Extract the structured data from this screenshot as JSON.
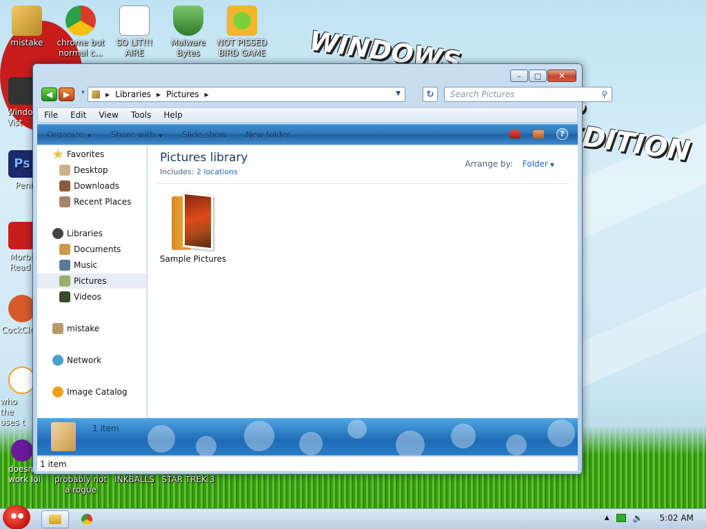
{
  "desktop": {
    "top_icons": [
      {
        "label": "mistake",
        "color": "#c89a2a"
      },
      {
        "label": "chrome but normal c...",
        "color": "#2a8ad8"
      },
      {
        "label": "SO LIT!!! AIRE",
        "color": "#ffffff"
      },
      {
        "label": "Malware Bytes",
        "color": "#4a9a3a"
      },
      {
        "label": "NOT PISSED BIRD GAME",
        "color": "#f2b62a"
      }
    ],
    "side_icons": [
      {
        "label": "Windo Vist",
        "color": "#333333"
      },
      {
        "label": "Peni",
        "color": "#1a2a6a"
      },
      {
        "label": "Morbi Read",
        "color": "#c81d1d"
      },
      {
        "label": "CockCle",
        "color": "#d85a2a"
      },
      {
        "label": "who the uses t",
        "color": "#f0a020"
      },
      {
        "label": "doesn't work lol",
        "color": "#6a1a9a"
      }
    ],
    "bottom_icons": [
      "probably not a rogue",
      "INKBALLS",
      "STAR TREK 3"
    ],
    "wallpaper_title_1": "WINDOWS",
    "wallpaper_title_2": "S EDITION"
  },
  "window": {
    "breadcrumb": [
      "Libraries",
      "Pictures"
    ],
    "search_placeholder": "Search Pictures",
    "menu": [
      "File",
      "Edit",
      "View",
      "Tools",
      "Help"
    ],
    "commands": [
      {
        "label": "Organize",
        "dropdown": true
      },
      {
        "label": "Share with",
        "dropdown": true
      },
      {
        "label": "Slide show",
        "dropdown": false
      },
      {
        "label": "New folder",
        "dropdown": false
      }
    ],
    "nav": {
      "favorites": {
        "label": "Favorites",
        "items": [
          "Desktop",
          "Downloads",
          "Recent Places"
        ]
      },
      "libraries": {
        "label": "Libraries",
        "items": [
          "Documents",
          "Music",
          "Pictures",
          "Videos"
        ],
        "selected": "Pictures"
      },
      "homegroup": "mistake",
      "network": "Network",
      "extra": "Image Catalog"
    },
    "content": {
      "title": "Pictures library",
      "includes_label": "Includes:",
      "includes_link": "2 locations",
      "arrange_label": "Arrange by:",
      "arrange_value": "Folder",
      "items": [
        {
          "name": "Sample Pictures",
          "type": "folder"
        }
      ]
    },
    "details_pane": {
      "text": "1 item"
    },
    "status": "1 item"
  },
  "taskbar": {
    "clock": "5:02 AM"
  }
}
